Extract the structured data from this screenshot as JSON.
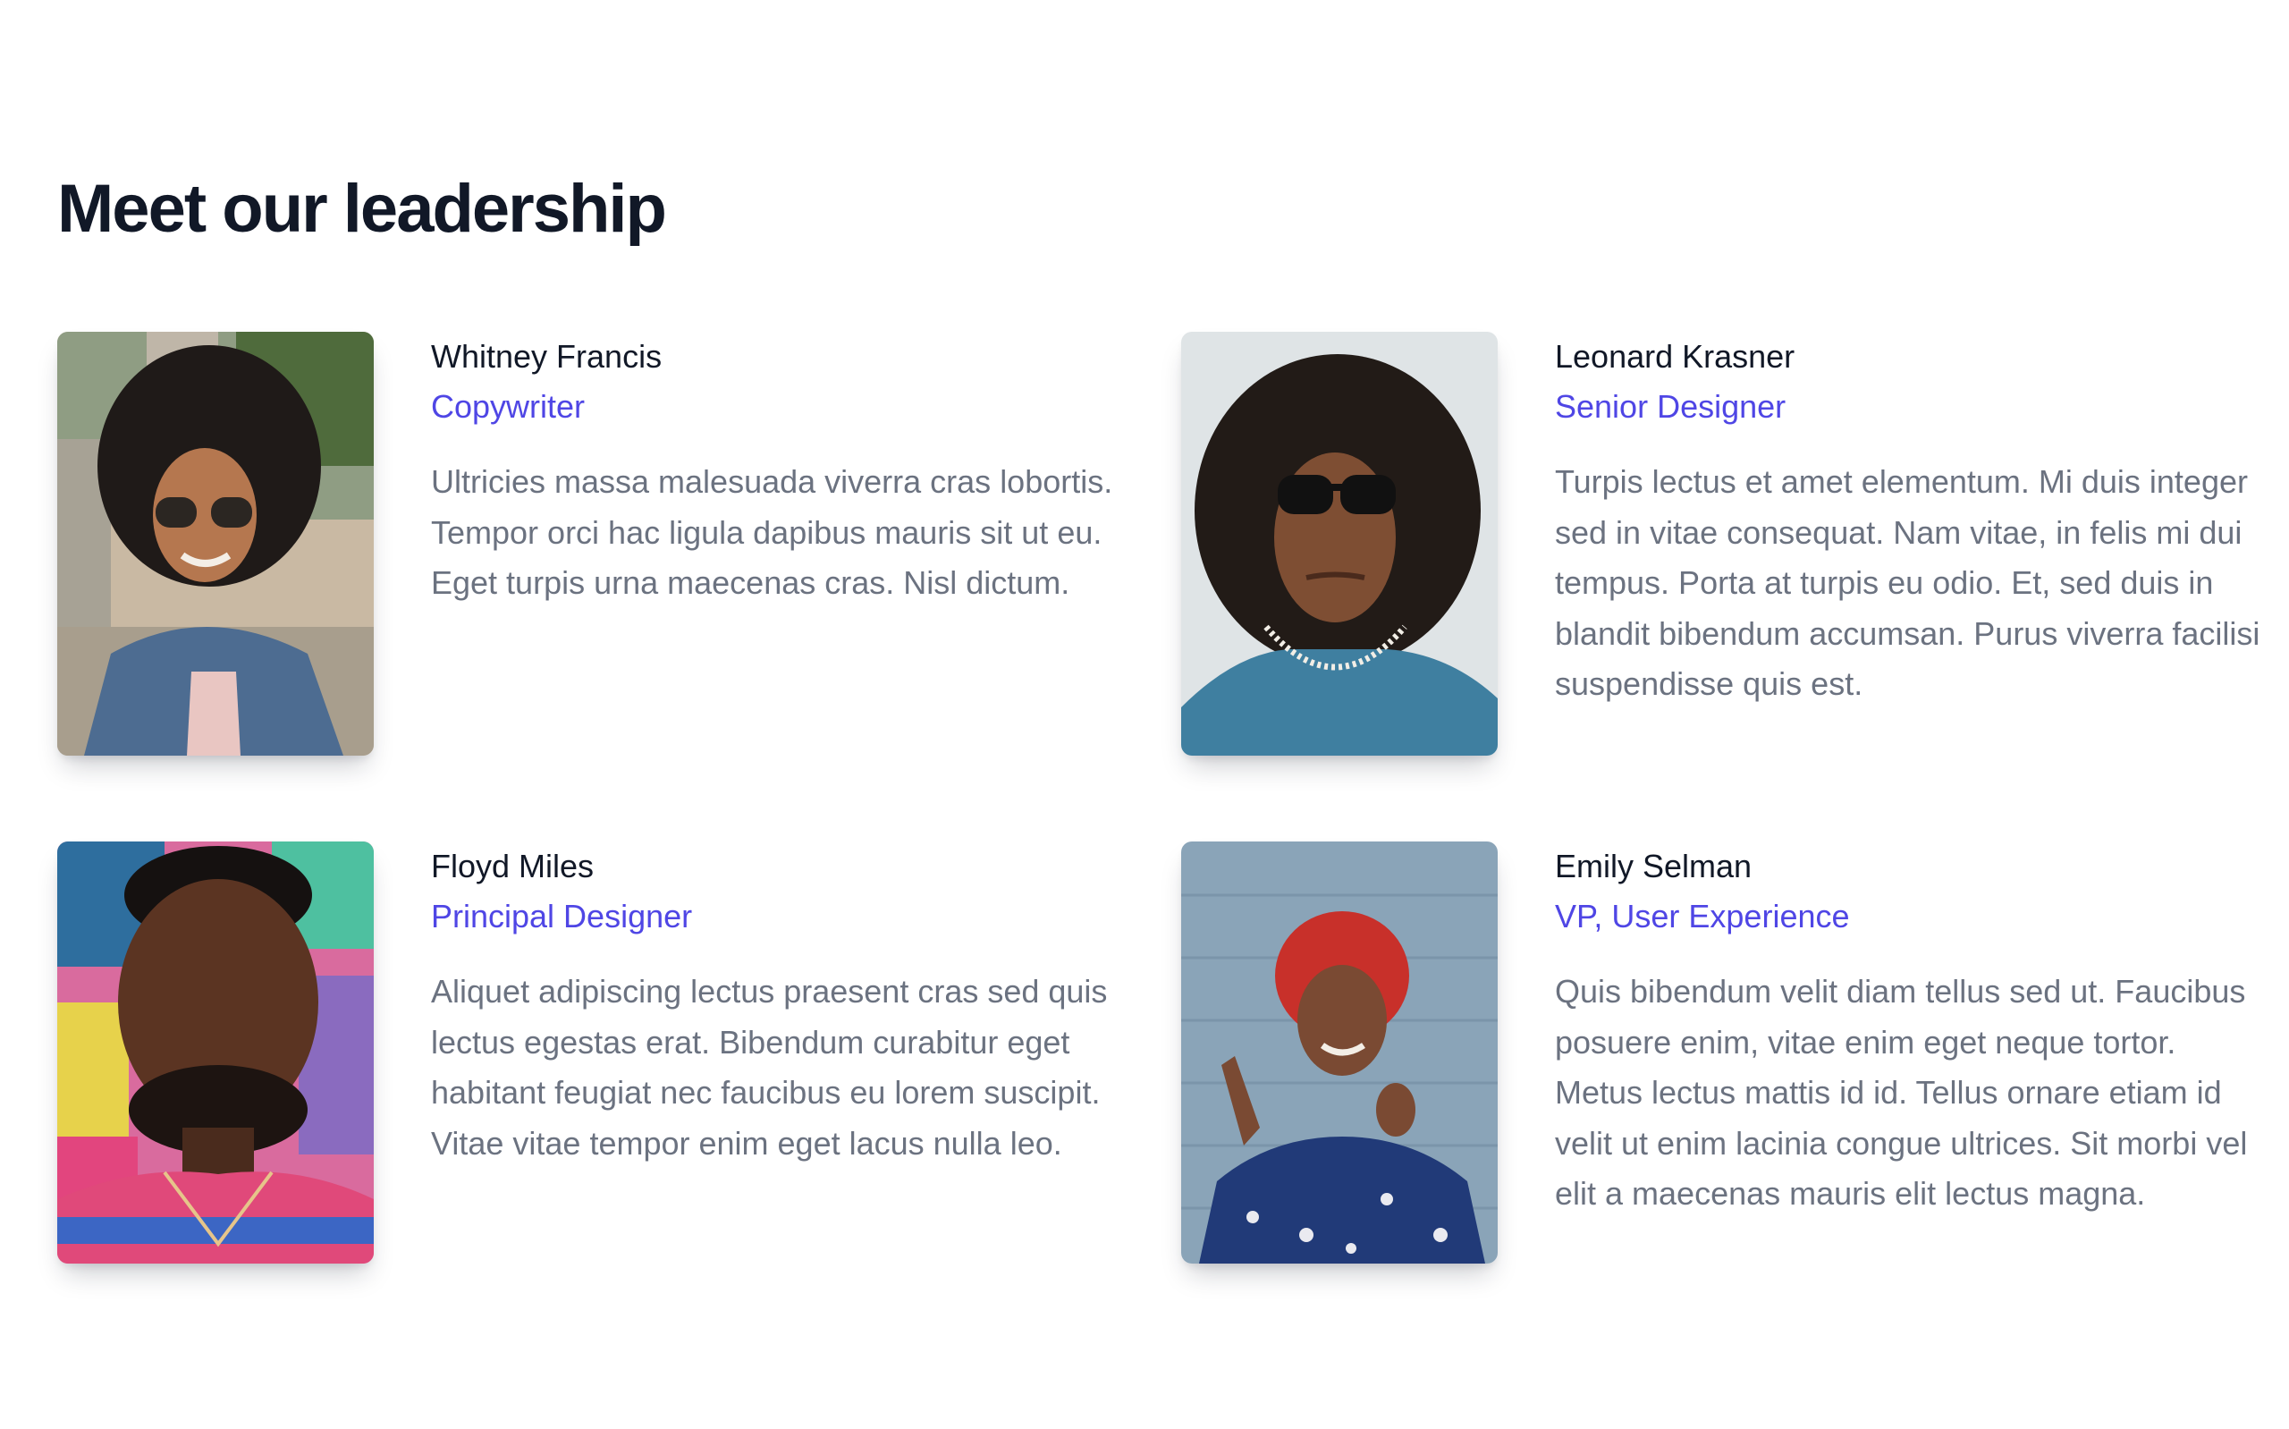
{
  "section": {
    "title": "Meet our leadership"
  },
  "people": [
    {
      "name": "Whitney Francis",
      "role": "Copywriter",
      "bio": "Ultricies massa malesuada viverra cras lobortis. Tempor orci hac ligula dapibus mauris sit ut eu. Eget turpis urna maecenas cras. Nisl dictum."
    },
    {
      "name": "Leonard Krasner",
      "role": "Senior Designer",
      "bio": "Turpis lectus et amet elementum. Mi duis integer sed in vitae consequat. Nam vitae, in felis mi dui tempus. Porta at turpis eu odio. Et, sed duis in blandit bibendum accumsan. Purus viverra facilisi suspendisse quis est."
    },
    {
      "name": "Floyd Miles",
      "role": "Principal Designer",
      "bio": "Aliquet adipiscing lectus praesent cras sed quis lectus egestas erat. Bibendum curabitur eget habitant feugiat nec faucibus eu lorem suscipit. Vitae vitae tempor enim eget lacus nulla leo."
    },
    {
      "name": "Emily Selman",
      "role": "VP, User Experience",
      "bio": "Quis bibendum velit diam tellus sed ut. Faucibus posuere enim, vitae enim eget neque tortor. Metus lectus mattis id id. Tellus ornare etiam id velit ut enim lacinia congue ultrices. Sit morbi vel elit a maecenas mauris elit lectus magna."
    }
  ],
  "colors": {
    "accent": "#4f46e5",
    "heading": "#111827",
    "body_text": "#6b7280"
  }
}
